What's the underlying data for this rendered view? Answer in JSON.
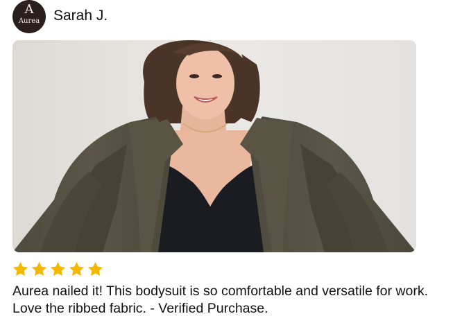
{
  "review": {
    "avatar": {
      "mark": "A",
      "wordmark": "Aurea",
      "background": "#2a1f1c",
      "text_color": "#f4ede6"
    },
    "reviewer_name": "Sarah J.",
    "photo": {
      "icon": "review-photo",
      "alt": ""
    },
    "rating": {
      "value": 5,
      "max": 5,
      "star_color": "#f5b800"
    },
    "text": "Aurea nailed it! This bodysuit is so comfortable and versatile for work. Love the ribbed fabric.  - Verified Purchase."
  }
}
